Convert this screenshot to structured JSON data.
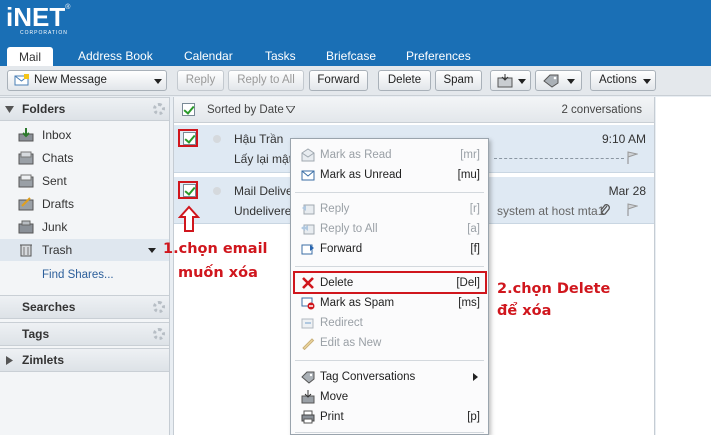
{
  "app": {
    "logo_text": "iNET",
    "logo_sub": "CORPORATION",
    "logo_reg": "®"
  },
  "tabs": [
    "Mail",
    "Address Book",
    "Calendar",
    "Tasks",
    "Briefcase",
    "Preferences"
  ],
  "toolbar": {
    "new_message": "New Message",
    "reply": "Reply",
    "reply_all": "Reply to All",
    "forward": "Forward",
    "delete": "Delete",
    "spam": "Spam",
    "actions": "Actions"
  },
  "sidebar": {
    "folders_header": "Folders",
    "folders": [
      "Inbox",
      "Chats",
      "Sent",
      "Drafts",
      "Junk",
      "Trash"
    ],
    "find_shares": "Find Shares...",
    "searches_header": "Searches",
    "tags_header": "Tags",
    "zimlets_header": "Zimlets"
  },
  "list": {
    "sorted_by": "Sorted by Date",
    "count": "2 conversations",
    "messages": [
      {
        "sender": "Hậu Trần",
        "subject": "Lấy lại mật k",
        "time": "9:10 AM"
      },
      {
        "sender": "Mail Deliver",
        "subject": "Undelivered",
        "snippet": "system at host mta1",
        "time": "Mar 28"
      }
    ]
  },
  "context_menu": {
    "groups": [
      [
        {
          "label": "Mark as Read",
          "key": "[mr]",
          "enabled": false,
          "icon": "mark-read-icon"
        },
        {
          "label": "Mark as Unread",
          "key": "[mu]",
          "enabled": true,
          "icon": "mark-unread-icon"
        }
      ],
      [
        {
          "label": "Reply",
          "key": "[r]",
          "enabled": false,
          "icon": "reply-icon"
        },
        {
          "label": "Reply to All",
          "key": "[a]",
          "enabled": false,
          "icon": "reply-all-icon"
        },
        {
          "label": "Forward",
          "key": "[f]",
          "enabled": true,
          "icon": "forward-icon"
        }
      ],
      [
        {
          "label": "Delete",
          "key": "[Del]",
          "enabled": true,
          "icon": "delete-icon"
        },
        {
          "label": "Mark as Spam",
          "key": "[ms]",
          "enabled": true,
          "icon": "spam-icon"
        },
        {
          "label": "Redirect",
          "key": "",
          "enabled": false,
          "icon": "redirect-icon"
        },
        {
          "label": "Edit as New",
          "key": "",
          "enabled": false,
          "icon": "edit-icon"
        }
      ],
      [
        {
          "label": "Tag Conversations",
          "key": "",
          "enabled": true,
          "icon": "tag-icon",
          "submenu": true
        },
        {
          "label": "Move",
          "key": "",
          "enabled": true,
          "icon": "move-icon"
        },
        {
          "label": "Print",
          "key": "[p]",
          "enabled": true,
          "icon": "print-icon"
        }
      ]
    ]
  },
  "annotations": {
    "step1_line1": "1.chọn email",
    "step1_line2": "muốn xóa",
    "step2_line1": "2.chọn Delete",
    "step2_line2": "để xóa"
  },
  "colors": {
    "brand_blue": "#1a6fb5",
    "highlight_red": "#d0161d",
    "selected_row": "#dfe9f3"
  }
}
